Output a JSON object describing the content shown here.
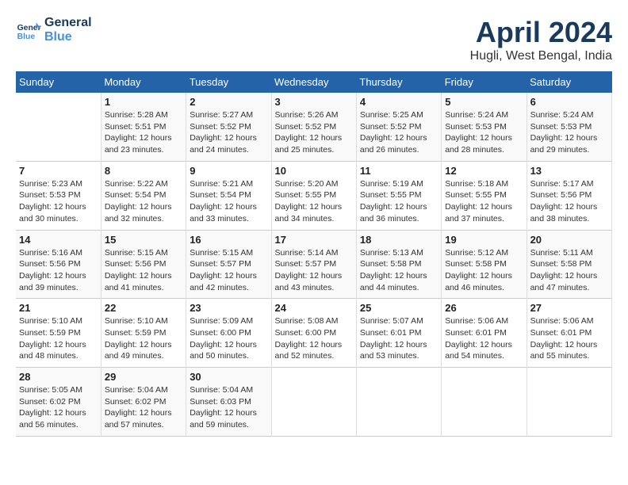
{
  "logo": {
    "text_general": "General",
    "text_blue": "Blue"
  },
  "header": {
    "month_year": "April 2024",
    "location": "Hugli, West Bengal, India"
  },
  "weekdays": [
    "Sunday",
    "Monday",
    "Tuesday",
    "Wednesday",
    "Thursday",
    "Friday",
    "Saturday"
  ],
  "weeks": [
    [
      {
        "num": "",
        "info": ""
      },
      {
        "num": "1",
        "info": "Sunrise: 5:28 AM\nSunset: 5:51 PM\nDaylight: 12 hours\nand 23 minutes."
      },
      {
        "num": "2",
        "info": "Sunrise: 5:27 AM\nSunset: 5:52 PM\nDaylight: 12 hours\nand 24 minutes."
      },
      {
        "num": "3",
        "info": "Sunrise: 5:26 AM\nSunset: 5:52 PM\nDaylight: 12 hours\nand 25 minutes."
      },
      {
        "num": "4",
        "info": "Sunrise: 5:25 AM\nSunset: 5:52 PM\nDaylight: 12 hours\nand 26 minutes."
      },
      {
        "num": "5",
        "info": "Sunrise: 5:24 AM\nSunset: 5:53 PM\nDaylight: 12 hours\nand 28 minutes."
      },
      {
        "num": "6",
        "info": "Sunrise: 5:24 AM\nSunset: 5:53 PM\nDaylight: 12 hours\nand 29 minutes."
      }
    ],
    [
      {
        "num": "7",
        "info": "Sunrise: 5:23 AM\nSunset: 5:53 PM\nDaylight: 12 hours\nand 30 minutes."
      },
      {
        "num": "8",
        "info": "Sunrise: 5:22 AM\nSunset: 5:54 PM\nDaylight: 12 hours\nand 32 minutes."
      },
      {
        "num": "9",
        "info": "Sunrise: 5:21 AM\nSunset: 5:54 PM\nDaylight: 12 hours\nand 33 minutes."
      },
      {
        "num": "10",
        "info": "Sunrise: 5:20 AM\nSunset: 5:55 PM\nDaylight: 12 hours\nand 34 minutes."
      },
      {
        "num": "11",
        "info": "Sunrise: 5:19 AM\nSunset: 5:55 PM\nDaylight: 12 hours\nand 36 minutes."
      },
      {
        "num": "12",
        "info": "Sunrise: 5:18 AM\nSunset: 5:55 PM\nDaylight: 12 hours\nand 37 minutes."
      },
      {
        "num": "13",
        "info": "Sunrise: 5:17 AM\nSunset: 5:56 PM\nDaylight: 12 hours\nand 38 minutes."
      }
    ],
    [
      {
        "num": "14",
        "info": "Sunrise: 5:16 AM\nSunset: 5:56 PM\nDaylight: 12 hours\nand 39 minutes."
      },
      {
        "num": "15",
        "info": "Sunrise: 5:15 AM\nSunset: 5:56 PM\nDaylight: 12 hours\nand 41 minutes."
      },
      {
        "num": "16",
        "info": "Sunrise: 5:15 AM\nSunset: 5:57 PM\nDaylight: 12 hours\nand 42 minutes."
      },
      {
        "num": "17",
        "info": "Sunrise: 5:14 AM\nSunset: 5:57 PM\nDaylight: 12 hours\nand 43 minutes."
      },
      {
        "num": "18",
        "info": "Sunrise: 5:13 AM\nSunset: 5:58 PM\nDaylight: 12 hours\nand 44 minutes."
      },
      {
        "num": "19",
        "info": "Sunrise: 5:12 AM\nSunset: 5:58 PM\nDaylight: 12 hours\nand 46 minutes."
      },
      {
        "num": "20",
        "info": "Sunrise: 5:11 AM\nSunset: 5:58 PM\nDaylight: 12 hours\nand 47 minutes."
      }
    ],
    [
      {
        "num": "21",
        "info": "Sunrise: 5:10 AM\nSunset: 5:59 PM\nDaylight: 12 hours\nand 48 minutes."
      },
      {
        "num": "22",
        "info": "Sunrise: 5:10 AM\nSunset: 5:59 PM\nDaylight: 12 hours\nand 49 minutes."
      },
      {
        "num": "23",
        "info": "Sunrise: 5:09 AM\nSunset: 6:00 PM\nDaylight: 12 hours\nand 50 minutes."
      },
      {
        "num": "24",
        "info": "Sunrise: 5:08 AM\nSunset: 6:00 PM\nDaylight: 12 hours\nand 52 minutes."
      },
      {
        "num": "25",
        "info": "Sunrise: 5:07 AM\nSunset: 6:01 PM\nDaylight: 12 hours\nand 53 minutes."
      },
      {
        "num": "26",
        "info": "Sunrise: 5:06 AM\nSunset: 6:01 PM\nDaylight: 12 hours\nand 54 minutes."
      },
      {
        "num": "27",
        "info": "Sunrise: 5:06 AM\nSunset: 6:01 PM\nDaylight: 12 hours\nand 55 minutes."
      }
    ],
    [
      {
        "num": "28",
        "info": "Sunrise: 5:05 AM\nSunset: 6:02 PM\nDaylight: 12 hours\nand 56 minutes."
      },
      {
        "num": "29",
        "info": "Sunrise: 5:04 AM\nSunset: 6:02 PM\nDaylight: 12 hours\nand 57 minutes."
      },
      {
        "num": "30",
        "info": "Sunrise: 5:04 AM\nSunset: 6:03 PM\nDaylight: 12 hours\nand 59 minutes."
      },
      {
        "num": "",
        "info": ""
      },
      {
        "num": "",
        "info": ""
      },
      {
        "num": "",
        "info": ""
      },
      {
        "num": "",
        "info": ""
      }
    ]
  ]
}
